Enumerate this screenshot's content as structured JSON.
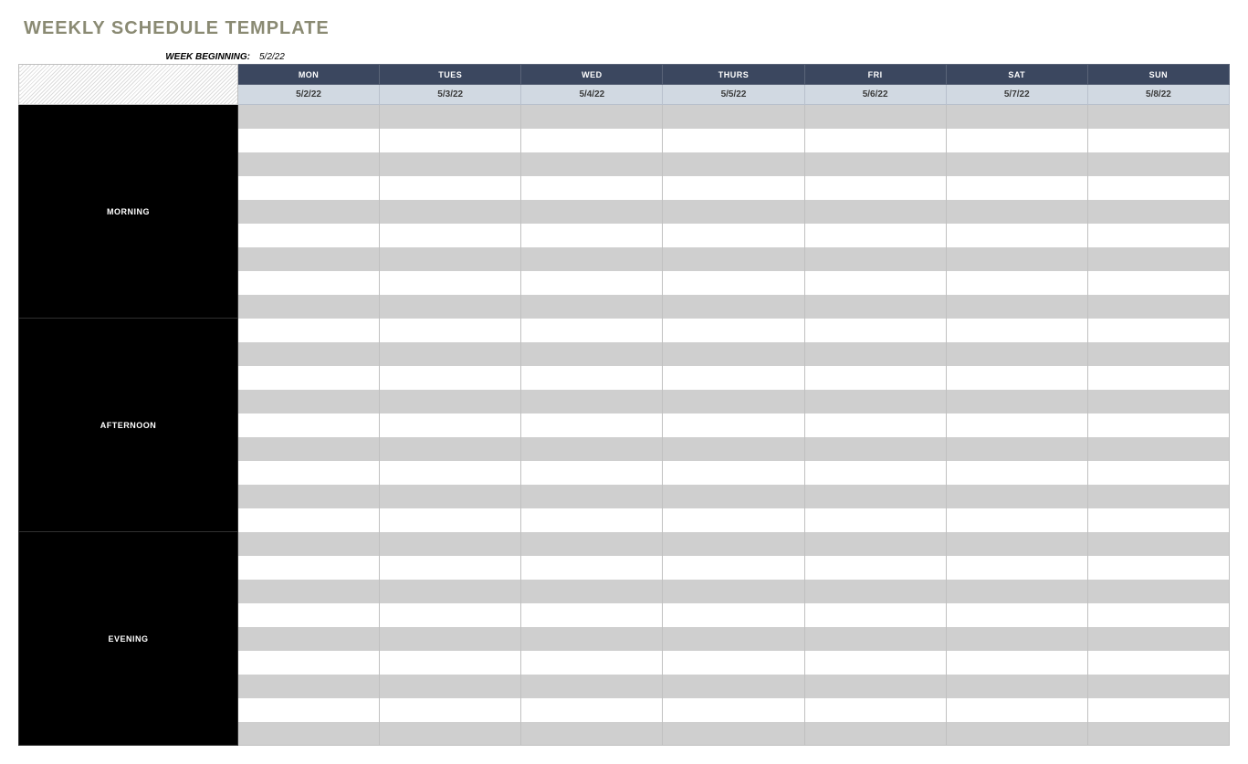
{
  "title": "WEEKLY SCHEDULE TEMPLATE",
  "week_beginning_label": "WEEK BEGINNING:",
  "week_beginning_value": "5/2/22",
  "days": [
    {
      "name": "MON",
      "date": "5/2/22"
    },
    {
      "name": "TUES",
      "date": "5/3/22"
    },
    {
      "name": "WED",
      "date": "5/4/22"
    },
    {
      "name": "THURS",
      "date": "5/5/22"
    },
    {
      "name": "FRI",
      "date": "5/6/22"
    },
    {
      "name": "SAT",
      "date": "5/7/22"
    },
    {
      "name": "SUN",
      "date": "5/8/22"
    }
  ],
  "blocks": [
    {
      "label": "MORNING",
      "rows": 9
    },
    {
      "label": "AFTERNOON",
      "rows": 9
    },
    {
      "label": "EVENING",
      "rows": 9
    }
  ]
}
